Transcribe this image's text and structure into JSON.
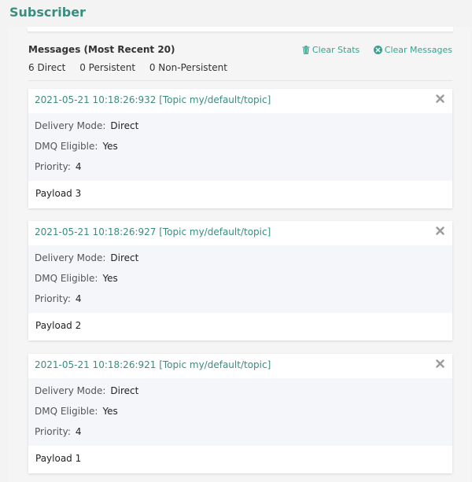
{
  "header": {
    "title": "Subscriber"
  },
  "messages": {
    "title": "Messages  (Most Recent 20)",
    "counts": [
      "6 Direct",
      "0 Persistent",
      "0 Non-Persistent"
    ],
    "actions": {
      "clear_stats": "Clear Stats",
      "clear_messages": "Clear Messages"
    },
    "labels": {
      "delivery_mode": "Delivery Mode:",
      "dmq": "DMQ Eligible:",
      "priority": "Priority:"
    },
    "items": [
      {
        "title": "2021-05-21 10:18:26:932 [Topic my/default/topic]",
        "delivery_mode": "Direct",
        "dmq": "Yes",
        "priority": "4",
        "payload": "Payload 3"
      },
      {
        "title": "2021-05-21 10:18:26:927 [Topic my/default/topic]",
        "delivery_mode": "Direct",
        "dmq": "Yes",
        "priority": "4",
        "payload": "Payload 2"
      },
      {
        "title": "2021-05-21 10:18:26:921 [Topic my/default/topic]",
        "delivery_mode": "Direct",
        "dmq": "Yes",
        "priority": "4",
        "payload": "Payload 1"
      }
    ]
  },
  "colors": {
    "accent": "#3aa18f",
    "header": "#3b8e7f",
    "card_body": "#f5f6fa"
  },
  "icons": {
    "clear_stats": "trash-icon",
    "clear_messages": "x-circle-icon",
    "close": "close-icon"
  }
}
